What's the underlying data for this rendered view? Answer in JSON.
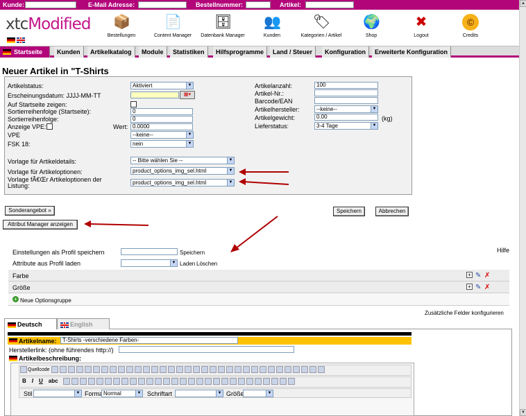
{
  "topbar": {
    "kunde": "Kunde:",
    "email": "E-Mail Adresse:",
    "bestellnummer": "Bestellnummer:",
    "artikel": "Artikel:"
  },
  "header": {
    "logo_prefix": "xtc",
    "logo_main": "Modified",
    "icons": [
      {
        "label": "Bestellungen",
        "icon": "box-icon",
        "glyph": "📦"
      },
      {
        "label": "Content Manager",
        "icon": "document-icon",
        "glyph": "📄"
      },
      {
        "label": "Datenbank Manager",
        "icon": "database-icon",
        "glyph": "🗄"
      },
      {
        "label": "Kunden",
        "icon": "users-icon",
        "glyph": "👥"
      },
      {
        "label": "Kategorien / Artikel",
        "icon": "tags-icon",
        "glyph": "🏷"
      },
      {
        "label": "Shop",
        "icon": "globe-icon",
        "glyph": "🌍"
      },
      {
        "label": "Logout",
        "icon": "logout-icon",
        "glyph": "✖"
      },
      {
        "label": "Credits",
        "icon": "credits-icon",
        "glyph": "©"
      }
    ]
  },
  "menu": [
    "Startseite",
    "Kunden",
    "Artikelkatalog",
    "Module",
    "Statistiken",
    "Hilfsprogramme",
    "Land / Steuer",
    "Konfiguration",
    "Erweiterte Konfiguration"
  ],
  "page_title": "Neuer Artikel in \"T-Shirts",
  "form": {
    "artikelstatus_label": "Artikelstatus:",
    "artikelstatus_value": "Aktiviert",
    "erscheinungsdatum_label": "Erscheinungsdatum: JJJJ-MM-TT",
    "startseite_label": "Auf Startseite zeigen:",
    "sort_start_label": "Sortierreihenfolge (Startseite):",
    "sort_start_value": "0",
    "sort_label": "Sortierreihenfolge:",
    "sort_value": "0",
    "vpe_show_label": "Anzeige VPE:",
    "wert_label": "Wert:",
    "wert_value": "0.0000",
    "vpe_label": "VPE",
    "vpe_value": "--keine--",
    "fsk_label": "FSK 18:",
    "fsk_value": "nein",
    "anzahl_label": "Artikelanzahl:",
    "anzahl_value": "100",
    "nr_label": "Artikel-Nr.:",
    "ean_label": "Barcode/EAN",
    "hersteller_label": "Artikelhersteller:",
    "hersteller_value": "--keine--",
    "gewicht_label": "Artikelgewicht:",
    "gewicht_value": "0.00",
    "gewicht_unit": "(kg)",
    "liefer_label": "Lieferstatus:",
    "liefer_value": "3-4 Tage",
    "vorlage_details_label": "Vorlage für Artikeldetails:",
    "vorlage_details_value": "-- Bitte wählen Sie --",
    "vorlage_opt_label": "Vorlage für Artikeloptionen:",
    "vorlage_opt_value": "product_options_img_sel.html",
    "vorlage_list_label": "Vorlage fÃ€Œr Artikeloptionen der Listung:",
    "vorlage_list_value": "product_options_img_sel.html"
  },
  "buttons": {
    "sonderangebot": "Sonderangebot »",
    "speichern": "Speichern",
    "abbrechen": "Abbrechen",
    "attribut_manager": "Attribut Manager anzeigen"
  },
  "attr": {
    "hilfe": "Hilfe",
    "profil_save_label": "Einstellungen als Profil speichern",
    "profil_save_btn": "Speichern",
    "profil_load_label": "Attribute aus Profil laden",
    "laden": "Laden",
    "loeschen": "Löschen",
    "groups": [
      "Farbe",
      "Größe"
    ],
    "new_group": "Neue Optionsgruppe",
    "extra_fields": "Zusätzliche Felder konfigurieren"
  },
  "lang_tabs": [
    "Deutsch",
    "English"
  ],
  "desc": {
    "name_label": "Artikelname:",
    "name_value": "T-Shirts -verschiedene Farben-",
    "link_label": "Herstellerlink: (ohne führendes http://)",
    "beschreibung_label": "Artikelbeschreibung:"
  },
  "toolbar": {
    "quellcode": "Quellcode",
    "stil": "Stil",
    "format": "Format",
    "format_value": "Normal",
    "schriftart": "Schriftart",
    "groesse": "Größe"
  },
  "colors": {
    "brand": "#b3057a",
    "highlight": "#ffc200",
    "field_yellow": "#ffffc0",
    "red_arrow": "#b00000"
  }
}
